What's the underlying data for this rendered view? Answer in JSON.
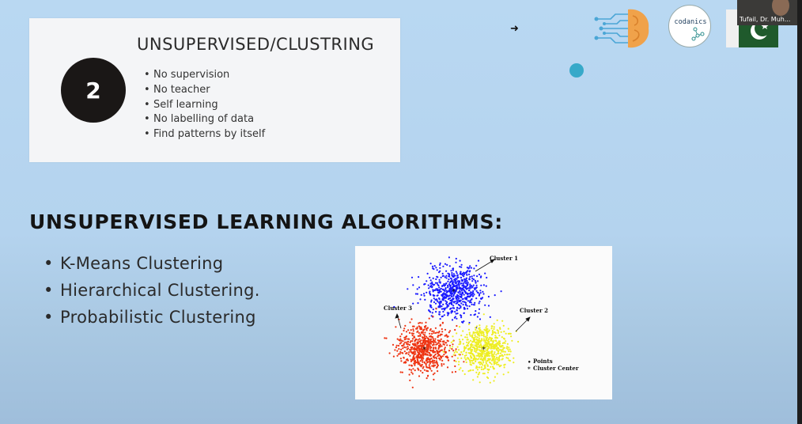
{
  "slide": {
    "card": {
      "number": "2",
      "title": "UNSUPERVISED/CLUSTRING",
      "bullets": [
        "No supervision",
        "No teacher",
        "Self learning",
        "No labelling of data",
        "Find patterns by itself"
      ]
    },
    "heading": "UNSUPERVISED LEARNING ALGORITHMS:",
    "algorithms": [
      "K-Means Clustering",
      "Hierarchical Clustering.",
      "Probabilistic Clustering"
    ],
    "logos": {
      "codanics": "codanics"
    },
    "colors": {
      "cluster_blue": "#1a1aff",
      "cluster_red": "#ee3311",
      "cluster_yellow": "#eeee22",
      "circle": "#1a1716",
      "teal": "#37a9c9"
    }
  },
  "video": {
    "participant_name": "Tufail, Dr. Muh..."
  },
  "figure": {
    "labels": {
      "cluster1": "Cluster 1",
      "cluster2": "Cluster 2",
      "cluster3": "Cluster 3"
    },
    "legend": {
      "points": "Points",
      "center": "Cluster Center"
    }
  },
  "icons": [
    "arrow-right-icon",
    "brain-circuit-icon",
    "codanics-logo",
    "pakistan-flag-icon",
    "teal-dot"
  ]
}
